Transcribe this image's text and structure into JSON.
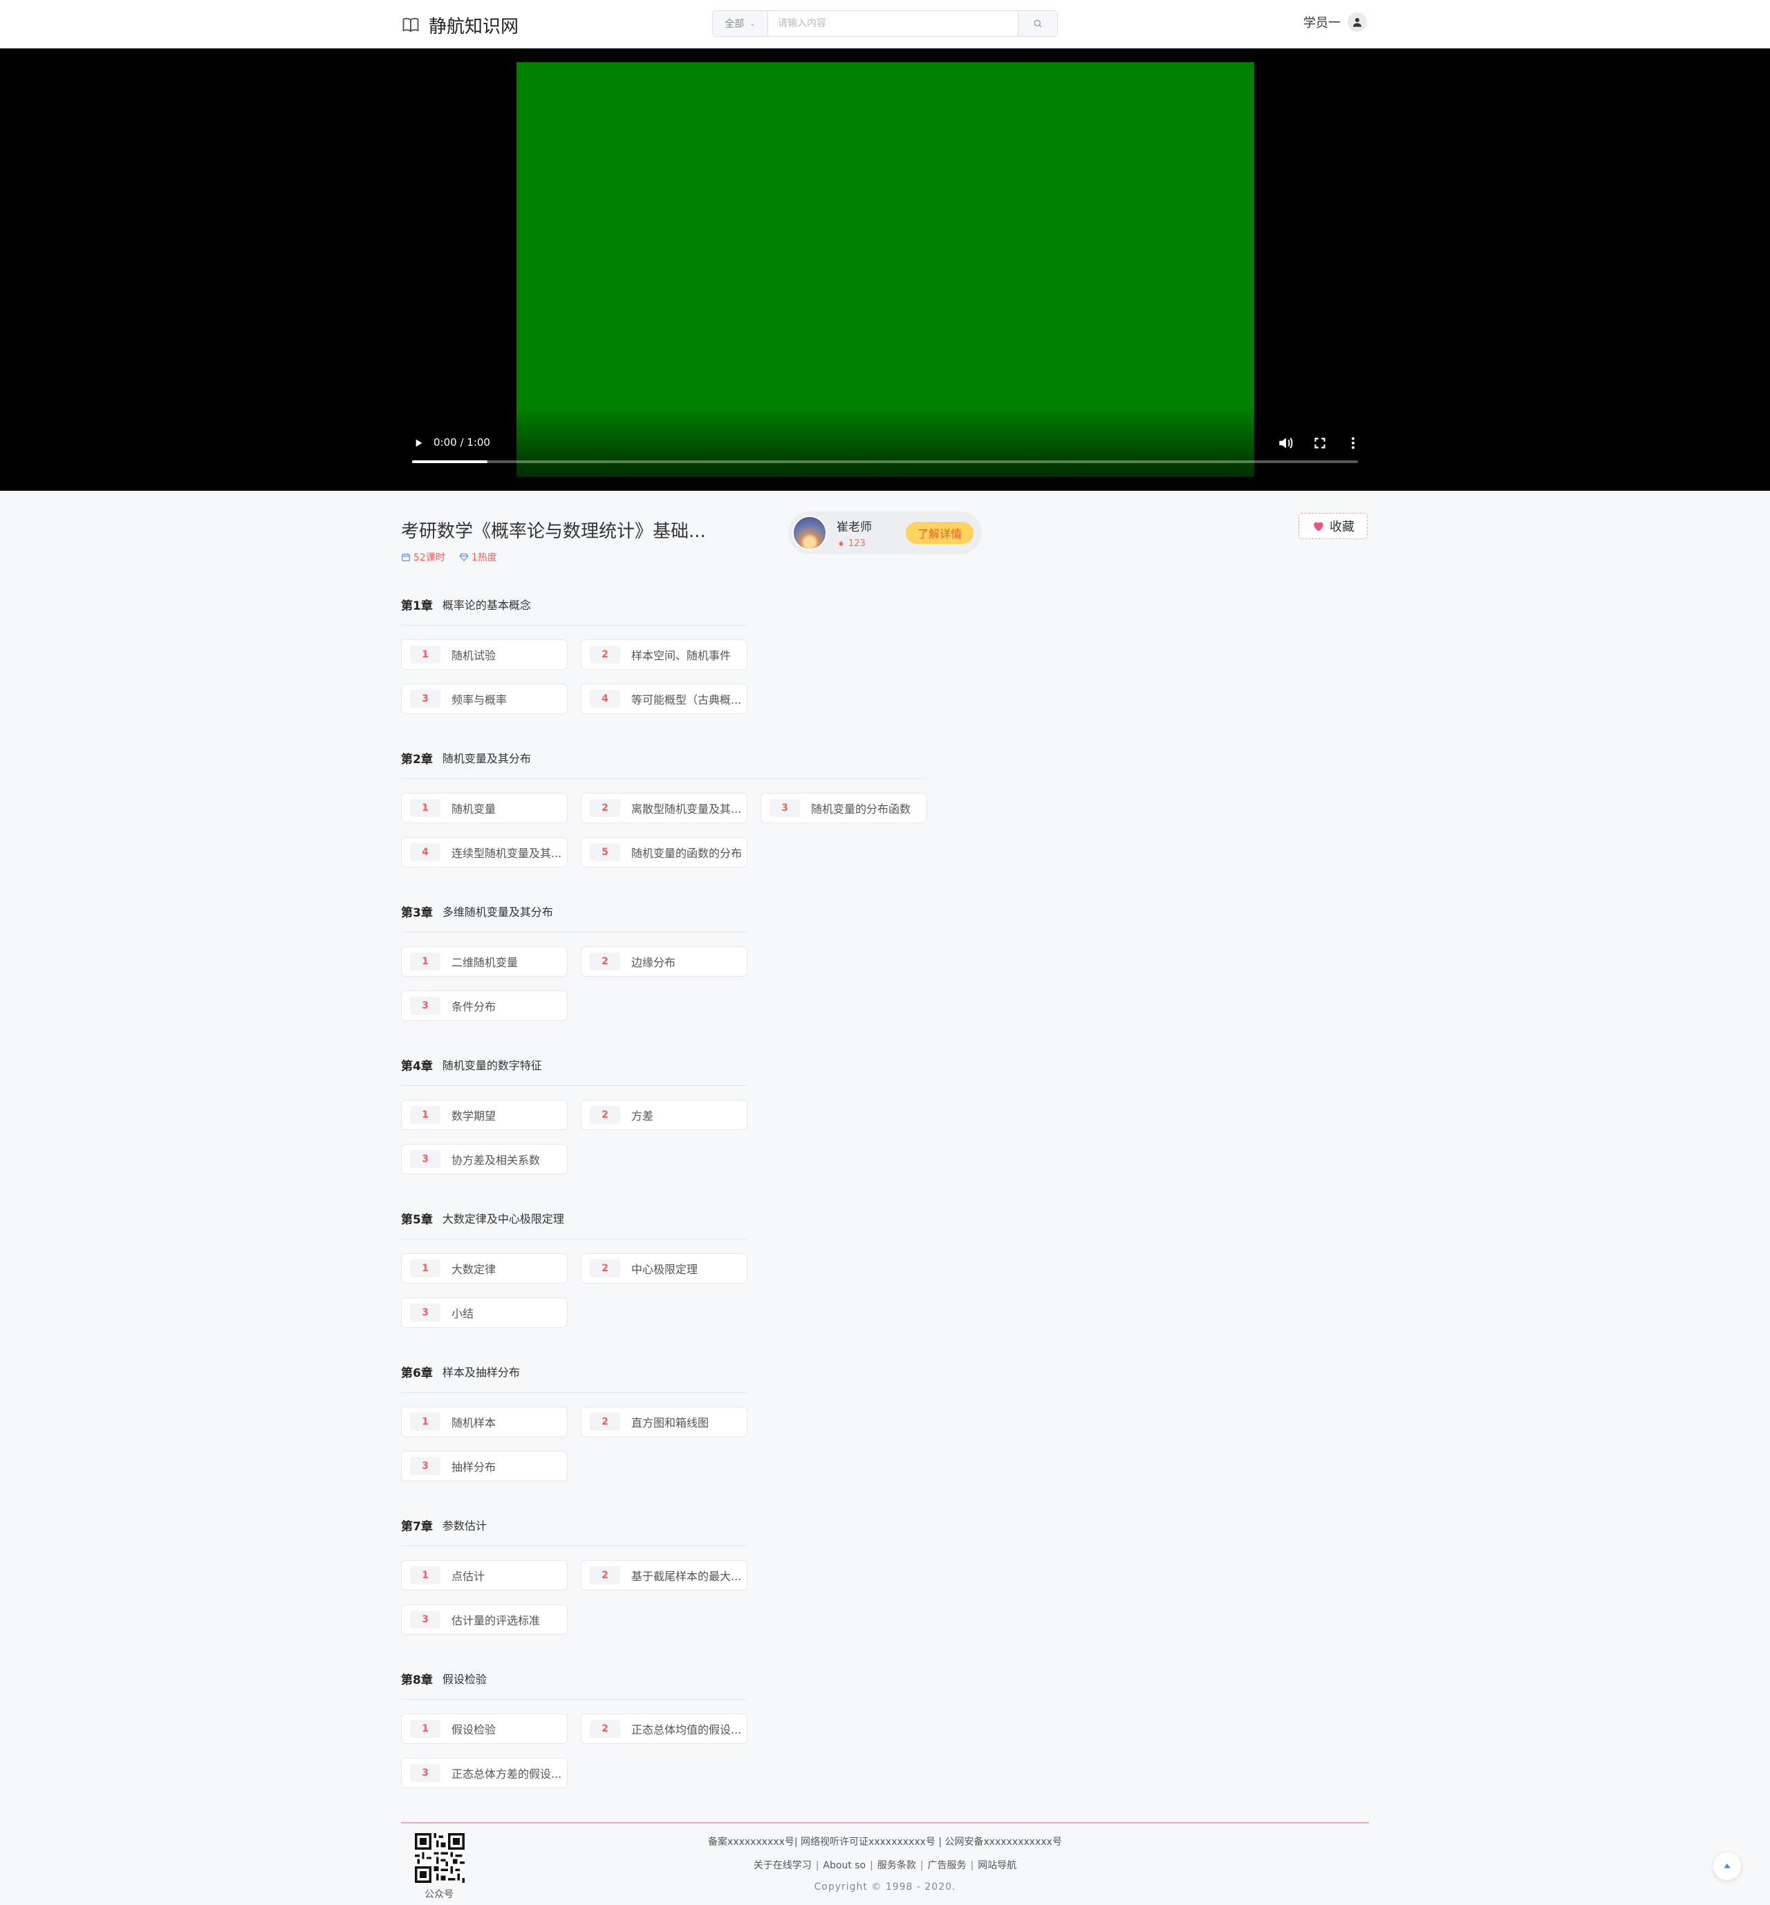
{
  "header": {
    "site_name": "静航知识网",
    "search_category": "全部",
    "search_placeholder": "请输入内容",
    "user_name": "学员一"
  },
  "video": {
    "time": "0:00 / 1:00",
    "progress": 0.08
  },
  "course": {
    "title": "考研数学《概率论与数理统计》基础...",
    "lessons": "52课时",
    "hot": "1热度",
    "teacher_name": "崔老师",
    "teacher_hot": "123",
    "detail_label": "了解详情",
    "fav_label": "收藏"
  },
  "chapters": [
    {
      "num": "第1章",
      "title": "概率论的基本概念",
      "lessons": [
        {
          "n": "1",
          "name": "随机试验"
        },
        {
          "n": "2",
          "name": "样本空间、随机事件"
        },
        {
          "n": "3",
          "name": "频率与概率"
        },
        {
          "n": "4",
          "name": "等可能概型（古典概..."
        }
      ]
    },
    {
      "num": "第2章",
      "title": "随机变量及其分布",
      "lessons": [
        {
          "n": "1",
          "name": "随机变量"
        },
        {
          "n": "2",
          "name": "离散型随机变量及其..."
        },
        {
          "n": "3",
          "name": "随机变量的分布函数"
        },
        {
          "n": "4",
          "name": "连续型随机变量及其..."
        },
        {
          "n": "5",
          "name": "随机变量的函数的分布"
        }
      ]
    },
    {
      "num": "第3章",
      "title": "多维随机变量及其分布",
      "lessons": [
        {
          "n": "1",
          "name": "二维随机变量"
        },
        {
          "n": "2",
          "name": "边缘分布"
        },
        {
          "n": "3",
          "name": "条件分布"
        }
      ]
    },
    {
      "num": "第4章",
      "title": "随机变量的数字特征",
      "lessons": [
        {
          "n": "1",
          "name": "数学期望"
        },
        {
          "n": "2",
          "name": "方差"
        },
        {
          "n": "3",
          "name": "协方差及相关系数"
        }
      ]
    },
    {
      "num": "第5章",
      "title": "大数定律及中心极限定理",
      "lessons": [
        {
          "n": "1",
          "name": "大数定律"
        },
        {
          "n": "2",
          "name": "中心极限定理"
        },
        {
          "n": "3",
          "name": "小结"
        }
      ]
    },
    {
      "num": "第6章",
      "title": "样本及抽样分布",
      "lessons": [
        {
          "n": "1",
          "name": "随机样本"
        },
        {
          "n": "2",
          "name": "直方图和箱线图"
        },
        {
          "n": "3",
          "name": "抽样分布"
        }
      ]
    },
    {
      "num": "第7章",
      "title": "参数估计",
      "lessons": [
        {
          "n": "1",
          "name": "点估计"
        },
        {
          "n": "2",
          "name": "基于截尾样本的最大..."
        },
        {
          "n": "3",
          "name": "估计量的评选标准"
        }
      ]
    },
    {
      "num": "第8章",
      "title": "假设检验",
      "lessons": [
        {
          "n": "1",
          "name": "假设检验"
        },
        {
          "n": "2",
          "name": "正态总体均值的假设..."
        },
        {
          "n": "3",
          "name": "正态总体方差的假设..."
        }
      ]
    }
  ],
  "footer": {
    "qr_label": "公众号",
    "line1": "备案xxxxxxxxxx号| 网络视听许可证xxxxxxxxxx号 | 公网安备xxxxxxxxxxxx号",
    "links": [
      "关于在线学习",
      "About so",
      "服务条款",
      "广告服务",
      "网站导航"
    ],
    "copyright": "Copyright © 1998 - 2020."
  }
}
